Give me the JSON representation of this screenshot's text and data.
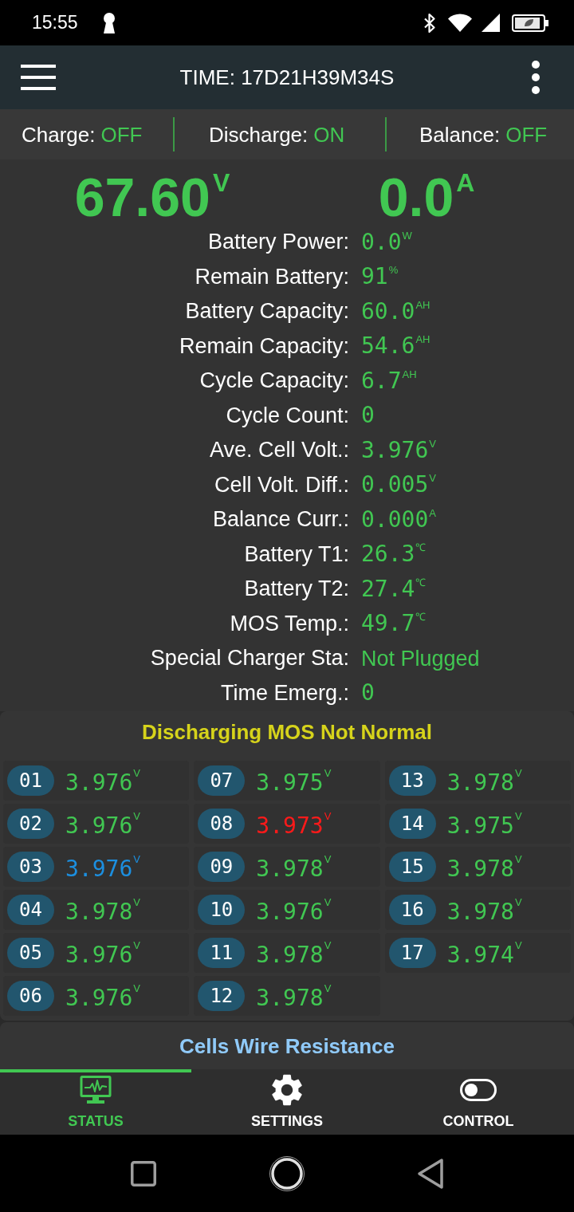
{
  "status_bar": {
    "time": "15:55"
  },
  "app_bar": {
    "title": "TIME: 17D21H39M34S"
  },
  "switches": [
    {
      "label": "Charge:",
      "state": "OFF"
    },
    {
      "label": "Discharge:",
      "state": "ON"
    },
    {
      "label": "Balance:",
      "state": "OFF"
    }
  ],
  "readings": [
    {
      "value": "67.60",
      "unit": "V"
    },
    {
      "value": "0.0",
      "unit": "A"
    }
  ],
  "stats": [
    {
      "label": "Battery Power:",
      "kind": "number",
      "value": "0.0",
      "unit": "W"
    },
    {
      "label": "Remain Battery:",
      "kind": "number",
      "value": "91",
      "unit": "%"
    },
    {
      "label": "Battery Capacity:",
      "kind": "number",
      "value": "60.0",
      "unit": "AH"
    },
    {
      "label": "Remain Capacity:",
      "kind": "number",
      "value": "54.6",
      "unit": "AH"
    },
    {
      "label": "Cycle Capacity:",
      "kind": "number",
      "value": "6.7",
      "unit": "AH"
    },
    {
      "label": "Cycle Count:",
      "kind": "number",
      "value": "0"
    },
    {
      "label": "Ave. Cell Volt.:",
      "kind": "number",
      "value": "3.976",
      "unit": "V"
    },
    {
      "label": "Cell Volt. Diff.:",
      "kind": "number",
      "value": "0.005",
      "unit": "V"
    },
    {
      "label": "Balance Curr.:",
      "kind": "number",
      "value": "0.000",
      "unit": "A"
    },
    {
      "label": "Battery T1:",
      "kind": "number",
      "value": "26.3",
      "unit": "℃"
    },
    {
      "label": "Battery T2:",
      "kind": "number",
      "value": "27.4",
      "unit": "℃"
    },
    {
      "label": "MOS Temp.:",
      "kind": "number",
      "value": "49.7",
      "unit": "℃"
    },
    {
      "label": "Special Charger Sta:",
      "kind": "text",
      "value": "Not Plugged"
    },
    {
      "label": "Time Emerg.:",
      "kind": "number",
      "value": "0"
    }
  ],
  "alert": "Discharging MOS Not Normal",
  "cells": [
    {
      "index": "01",
      "value": "3.976",
      "unit": "V",
      "color": "#41c752"
    },
    {
      "index": "02",
      "value": "3.976",
      "unit": "V",
      "color": "#41c752"
    },
    {
      "index": "03",
      "value": "3.976",
      "unit": "V",
      "color": "#1c8fe0"
    },
    {
      "index": "04",
      "value": "3.978",
      "unit": "V",
      "color": "#41c752"
    },
    {
      "index": "05",
      "value": "3.976",
      "unit": "V",
      "color": "#41c752"
    },
    {
      "index": "06",
      "value": "3.976",
      "unit": "V",
      "color": "#41c752"
    },
    {
      "index": "07",
      "value": "3.975",
      "unit": "V",
      "color": "#41c752"
    },
    {
      "index": "08",
      "value": "3.973",
      "unit": "V",
      "color": "#ff1a1a"
    },
    {
      "index": "09",
      "value": "3.978",
      "unit": "V",
      "color": "#41c752"
    },
    {
      "index": "10",
      "value": "3.976",
      "unit": "V",
      "color": "#41c752"
    },
    {
      "index": "11",
      "value": "3.978",
      "unit": "V",
      "color": "#41c752"
    },
    {
      "index": "12",
      "value": "3.978",
      "unit": "V",
      "color": "#41c752"
    },
    {
      "index": "13",
      "value": "3.978",
      "unit": "V",
      "color": "#41c752"
    },
    {
      "index": "14",
      "value": "3.975",
      "unit": "V",
      "color": "#41c752"
    },
    {
      "index": "15",
      "value": "3.978",
      "unit": "V",
      "color": "#41c752"
    },
    {
      "index": "16",
      "value": "3.978",
      "unit": "V",
      "color": "#41c752"
    },
    {
      "index": "17",
      "value": "3.974",
      "unit": "V",
      "color": "#41c752"
    }
  ],
  "wire_resistance": "Cells Wire Resistance",
  "tabs": [
    {
      "label": "STATUS",
      "selected": true
    },
    {
      "label": "SETTINGS",
      "selected": false
    },
    {
      "label": "CONTROL",
      "selected": false
    }
  ]
}
